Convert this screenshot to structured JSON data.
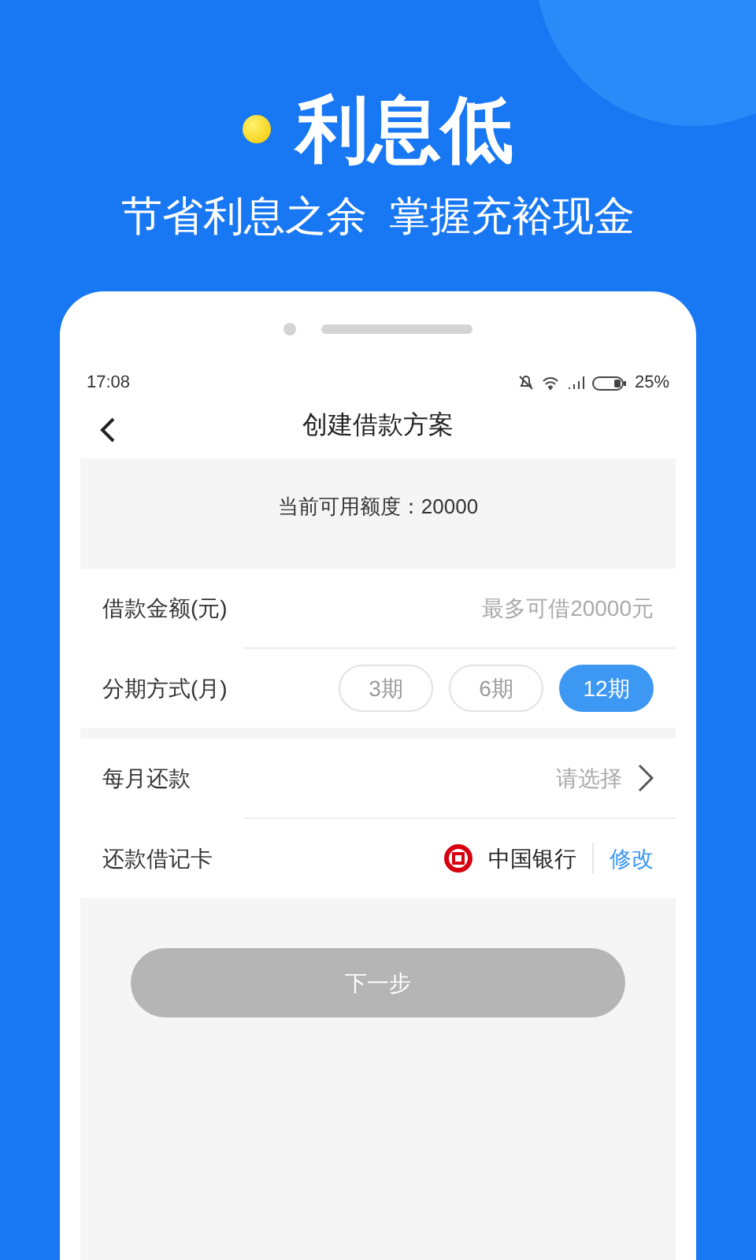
{
  "banner": {
    "headline": "利息低",
    "subtitle": "节省利息之余  掌握充裕现金"
  },
  "status_bar": {
    "time": "17:08",
    "battery": "25%"
  },
  "header": {
    "title": "创建借款方案"
  },
  "quota": {
    "text": "当前可用额度：20000"
  },
  "form": [
    {
      "kind": "input",
      "label": "借款金额(元)",
      "placeholder": "最多可借20000元"
    },
    {
      "kind": "options",
      "label": "分期方式(月)",
      "options": [
        {
          "label": "3期",
          "selected": false
        },
        {
          "label": "6期",
          "selected": false
        },
        {
          "label": "12期",
          "selected": true
        }
      ]
    },
    {
      "kind": "select",
      "label": "每月还款",
      "value": "请选择"
    },
    {
      "kind": "card",
      "label": "还款借记卡",
      "bank": "中国银行",
      "action": "修改"
    }
  ],
  "next_button": {
    "label": "下一步",
    "disabled": true
  }
}
